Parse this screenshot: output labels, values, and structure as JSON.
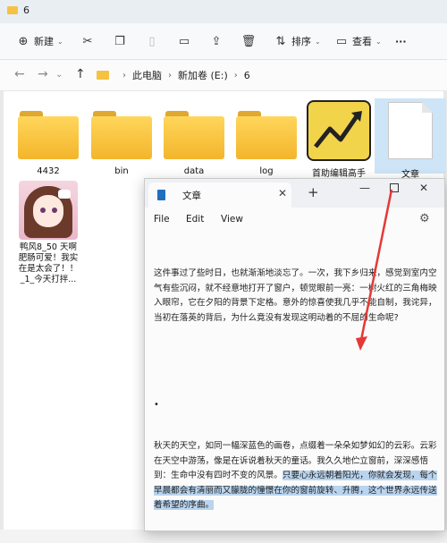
{
  "explorer": {
    "window_title": "6",
    "toolbar": {
      "new_label": "新建",
      "sort_label": "排序",
      "view_label": "查看",
      "more_label": "···"
    },
    "breadcrumbs": [
      "此电脑",
      "新加卷 (E:)",
      "6"
    ],
    "files": [
      {
        "name": "4432",
        "type": "folder"
      },
      {
        "name": "bin",
        "type": "folder"
      },
      {
        "name": "data",
        "type": "folder"
      },
      {
        "name": "log",
        "type": "folder"
      },
      {
        "name": "首助编辑高手",
        "type": "app"
      },
      {
        "name": "文章",
        "type": "text-document"
      },
      {
        "name": "鸭风8_50 天啊 肥肠可爱！我实 在是太会了！！_1_今天打拌...",
        "type": "image"
      }
    ],
    "avatar_caption_lines": [
      "鸭风8_50 天啊",
      "肥肠可爱！我实",
      "在是太会了！！",
      "_1_今天打拌..."
    ]
  },
  "notepad": {
    "tab_title": "文章",
    "menu": {
      "file": "File",
      "edit": "Edit",
      "view": "View"
    },
    "paragraph1": "这件事过了些时日，也就渐渐地淡忘了。一次，我下乡归来，感觉到室内空气有些沉闷，就不经意地打开了窗户，顿觉眼前一亮：一树火红的三角梅映入眼帘，它在夕阳的背景下定格。意外的惊喜使我几乎不能自制，我诧异，当初在落英的背后，为什么竟没有发现这明动着的不屈的生命呢?",
    "bullet": "•",
    "paragraph2_plain": "秋天的天空，如同一幅深蓝色的画卷，点缀着一朵朵如梦如幻的云彩。云彩在天空中游荡，像是在诉说着秋天的童话。我久久地伫立窗前，深深感悟到：生命中没有四时不变的风景。",
    "paragraph2_highlight": "只要心永远朝着阳光，你就会发现，每个早晨都会有清丽而又朦胧的憧憬在你的窗前旋转、升腾，这个世界永远传送着希望的序曲。"
  },
  "colors": {
    "folder_yellow": "#f5c242",
    "selection_blue": "#cde5f6",
    "text_highlight": "#b9d4ee",
    "annotation_red": "#e53935"
  }
}
